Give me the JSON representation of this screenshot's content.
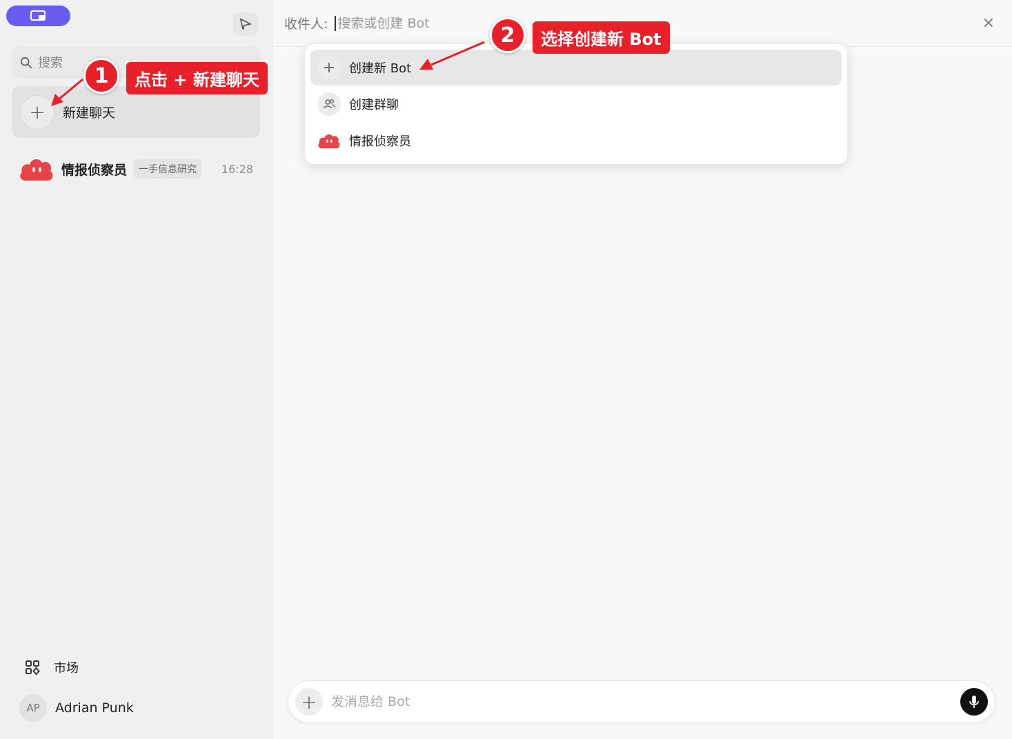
{
  "sidebar": {
    "search_placeholder": "搜索",
    "new_chat_label": "新建聊天",
    "chats": [
      {
        "name": "情报侦察员",
        "tag": "一手信息研究",
        "time": "16:28"
      }
    ],
    "market_label": "市场",
    "user": {
      "initials": "AP",
      "name": "Adrian Punk"
    }
  },
  "header": {
    "recipient_label": "收件人:",
    "recipient_placeholder": "搜索或创建 Bot"
  },
  "dropdown": {
    "items": [
      {
        "label": "创建新 Bot",
        "icon": "plus-icon"
      },
      {
        "label": "创建群聊",
        "icon": "group-icon"
      },
      {
        "label": "情报侦察员",
        "icon": "cloud-avatar-icon"
      }
    ]
  },
  "composer": {
    "placeholder": "发消息给 Bot"
  },
  "annotations": {
    "step1_number": "1",
    "step1_text": "点击 + 新建聊天",
    "step2_number": "2",
    "step2_text": "选择创建新 Bot"
  },
  "colors": {
    "accent": "#6a5cf0",
    "annotation_red": "#e8202a",
    "avatar_red": "#e9434a"
  }
}
